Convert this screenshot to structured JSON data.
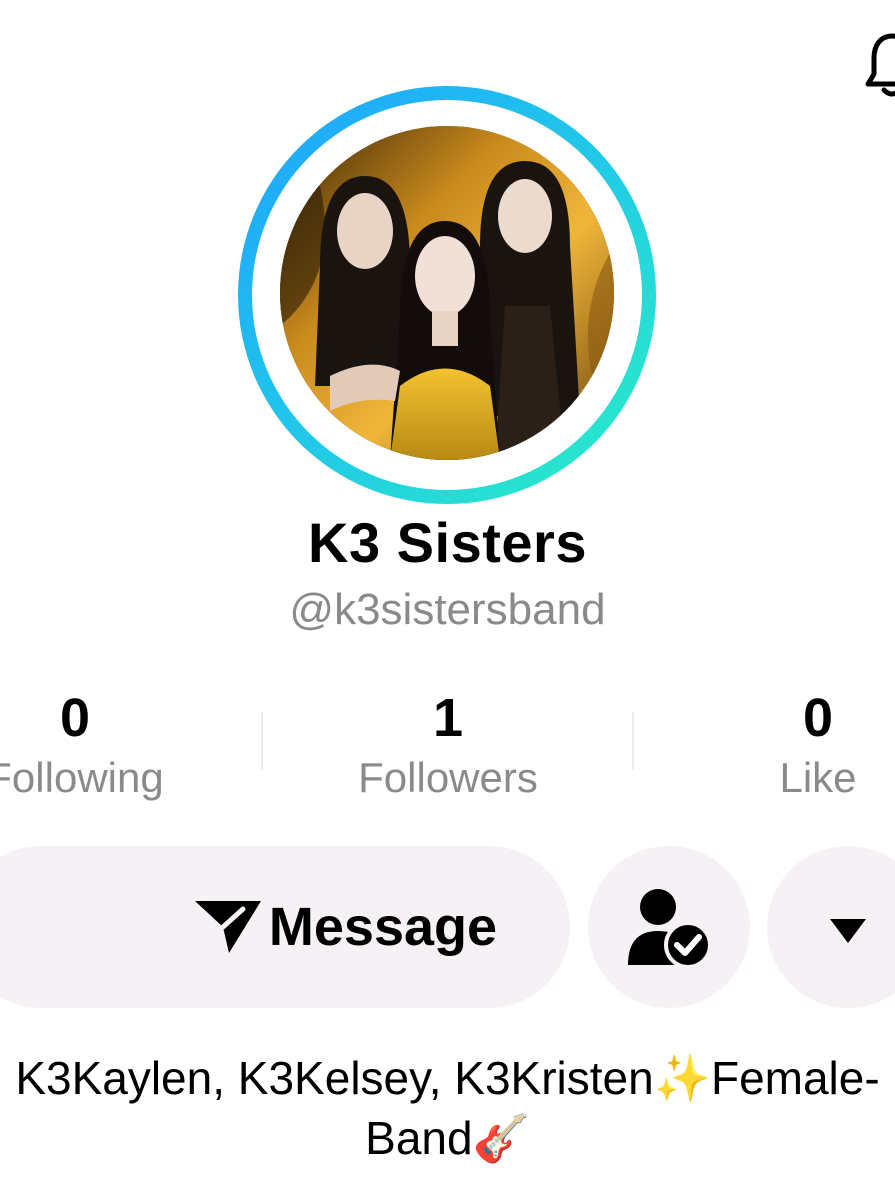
{
  "header": {
    "notification_icon": "bell-icon"
  },
  "profile": {
    "avatar_icon": "profile-photo-three-women-gold-background",
    "ring_colors": [
      "#1fa2ff",
      "#2bf0c4"
    ],
    "display_name": "K3 Sisters",
    "username": "@k3sistersband"
  },
  "stats": {
    "following": {
      "value": "0",
      "label": "Following"
    },
    "followers": {
      "value": "1",
      "label": "Followers"
    },
    "likes": {
      "value": "0",
      "label": "Like"
    }
  },
  "actions": {
    "message_label": "Message",
    "message_icon": "send-arrow-icon",
    "friend_icon": "user-check-icon",
    "more_icon": "caret-down-icon"
  },
  "bio": {
    "line1": "K3Kaylen, K3Kelsey, K3Kristen✨Female-",
    "line2": "Band🎸"
  }
}
